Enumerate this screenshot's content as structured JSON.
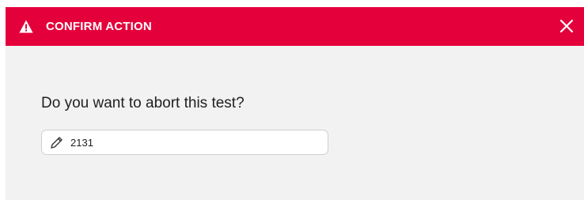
{
  "dialog": {
    "title": "CONFIRM ACTION",
    "header_color": "#e4003b",
    "header_icon": "warning-triangle-icon",
    "close_icon": "close-icon",
    "question": "Do you want to abort this test?",
    "field": {
      "icon": "pencil-icon",
      "value": "2131"
    }
  }
}
